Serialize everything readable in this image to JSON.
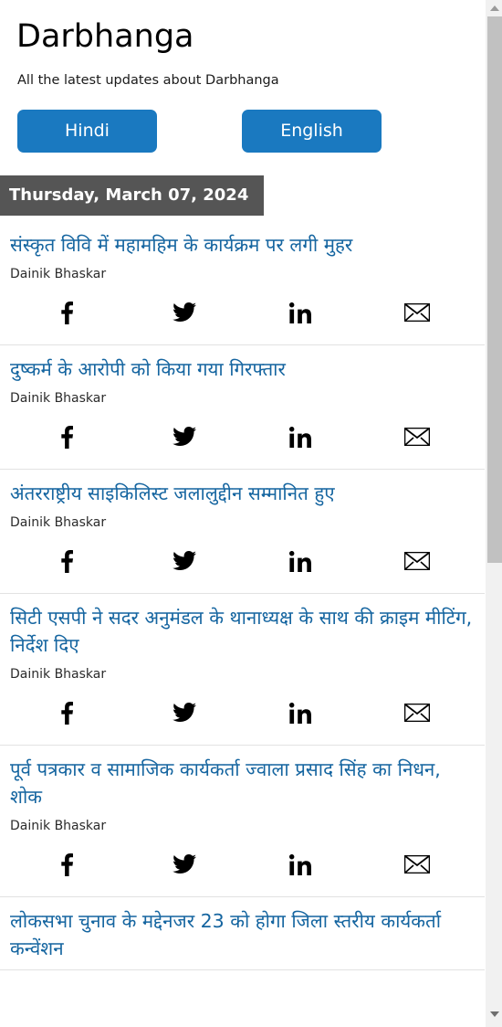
{
  "header": {
    "title": "Darbhanga",
    "subtitle": "All the latest updates about Darbhanga",
    "buttons": [
      {
        "label": "Hindi",
        "name": "hindi-button"
      },
      {
        "label": "English",
        "name": "english-button"
      }
    ]
  },
  "date_badge": "Thursday, March 07, 2024",
  "share": {
    "facebook": "facebook-icon",
    "twitter": "twitter-icon",
    "linkedin": "linkedin-icon",
    "email": "email-icon"
  },
  "articles": [
    {
      "title": "संस्कृत विवि में महामहिम के कार्यक्रम पर लगी मुहर",
      "source": "Dainik Bhaskar"
    },
    {
      "title": "दुष्कर्म के आरोपी को किया गया गिरफ्तार",
      "source": "Dainik Bhaskar"
    },
    {
      "title": "अंतरराष्ट्रीय साइकिलिस्ट जलालुद्दीन सम्मानित हुए",
      "source": "Dainik Bhaskar"
    },
    {
      "title": "सिटी एसपी ने सदर अनुमंडल के थानाध्यक्ष के साथ की क्राइम मीटिंग, निर्देश दिए",
      "source": "Dainik Bhaskar"
    },
    {
      "title": "पूर्व पत्रकार व सामाजिक कार्यकर्ता ज्वाला प्रसाद सिंह का निधन, शोक",
      "source": "Dainik Bhaskar"
    },
    {
      "title": "लोकसभा चुनाव के मद्देनजर 23 को होगा जिला स्तरीय कार्यकर्ता कन्वेंशन",
      "source": ""
    }
  ],
  "colors": {
    "accent": "#1a79c0",
    "link": "#1565a0",
    "date_badge_bg": "#555555",
    "divider": "#e2e2e2"
  },
  "scrollbar": {
    "up_arrow": "scroll-up-arrow-icon",
    "down_arrow": "scroll-down-arrow-icon"
  }
}
